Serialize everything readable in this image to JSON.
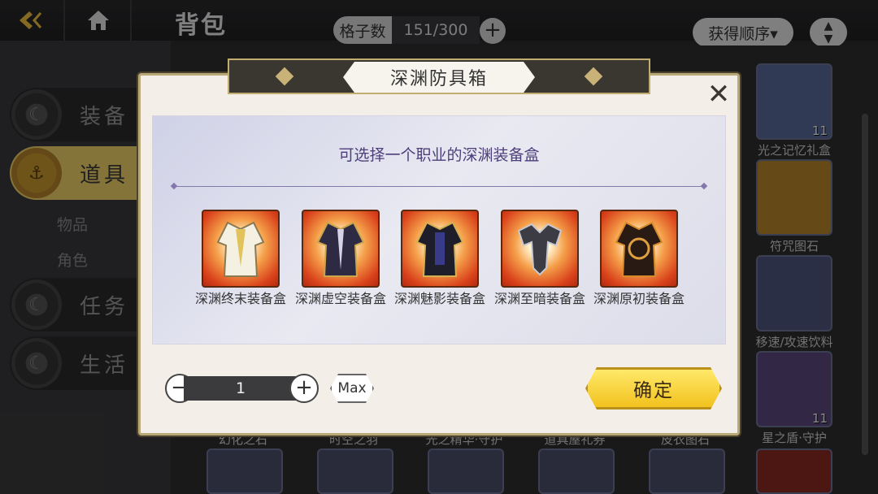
{
  "topbar": {
    "title": "背包",
    "slot_label": "格子数",
    "slot_count": "151/300",
    "slot_add": "+",
    "sort_label": "获得顺序▾"
  },
  "leftnav": {
    "items": [
      {
        "label": "装备"
      },
      {
        "label": "道具"
      },
      {
        "label": "任务"
      },
      {
        "label": "生活"
      }
    ],
    "subitems": [
      {
        "label": "物品"
      },
      {
        "label": "角色"
      }
    ]
  },
  "inventory": {
    "right_items": [
      {
        "label": "光之记忆礼盒",
        "count": "11"
      },
      {
        "label": "符咒图石"
      },
      {
        "label": "移速/攻速饮料"
      },
      {
        "label": "星之盾·守护",
        "count": "11"
      }
    ],
    "bottom_labels": [
      "幻化之石",
      "时空之羽",
      "光之精华·守护",
      "道具屋礼券",
      "皮衣图石"
    ]
  },
  "dialog": {
    "title": "深渊防具箱",
    "close": "✕",
    "subtitle": "可选择一个职业的深渊装备盒",
    "options": [
      {
        "label": "深渊终末装备盒"
      },
      {
        "label": "深渊虚空装备盒"
      },
      {
        "label": "深渊魅影装备盒"
      },
      {
        "label": "深渊至暗装备盒"
      },
      {
        "label": "深渊原初装备盒"
      }
    ],
    "quantity": {
      "minus": "−",
      "value": "1",
      "plus": "+",
      "max": "Max"
    },
    "confirm": "确定"
  }
}
